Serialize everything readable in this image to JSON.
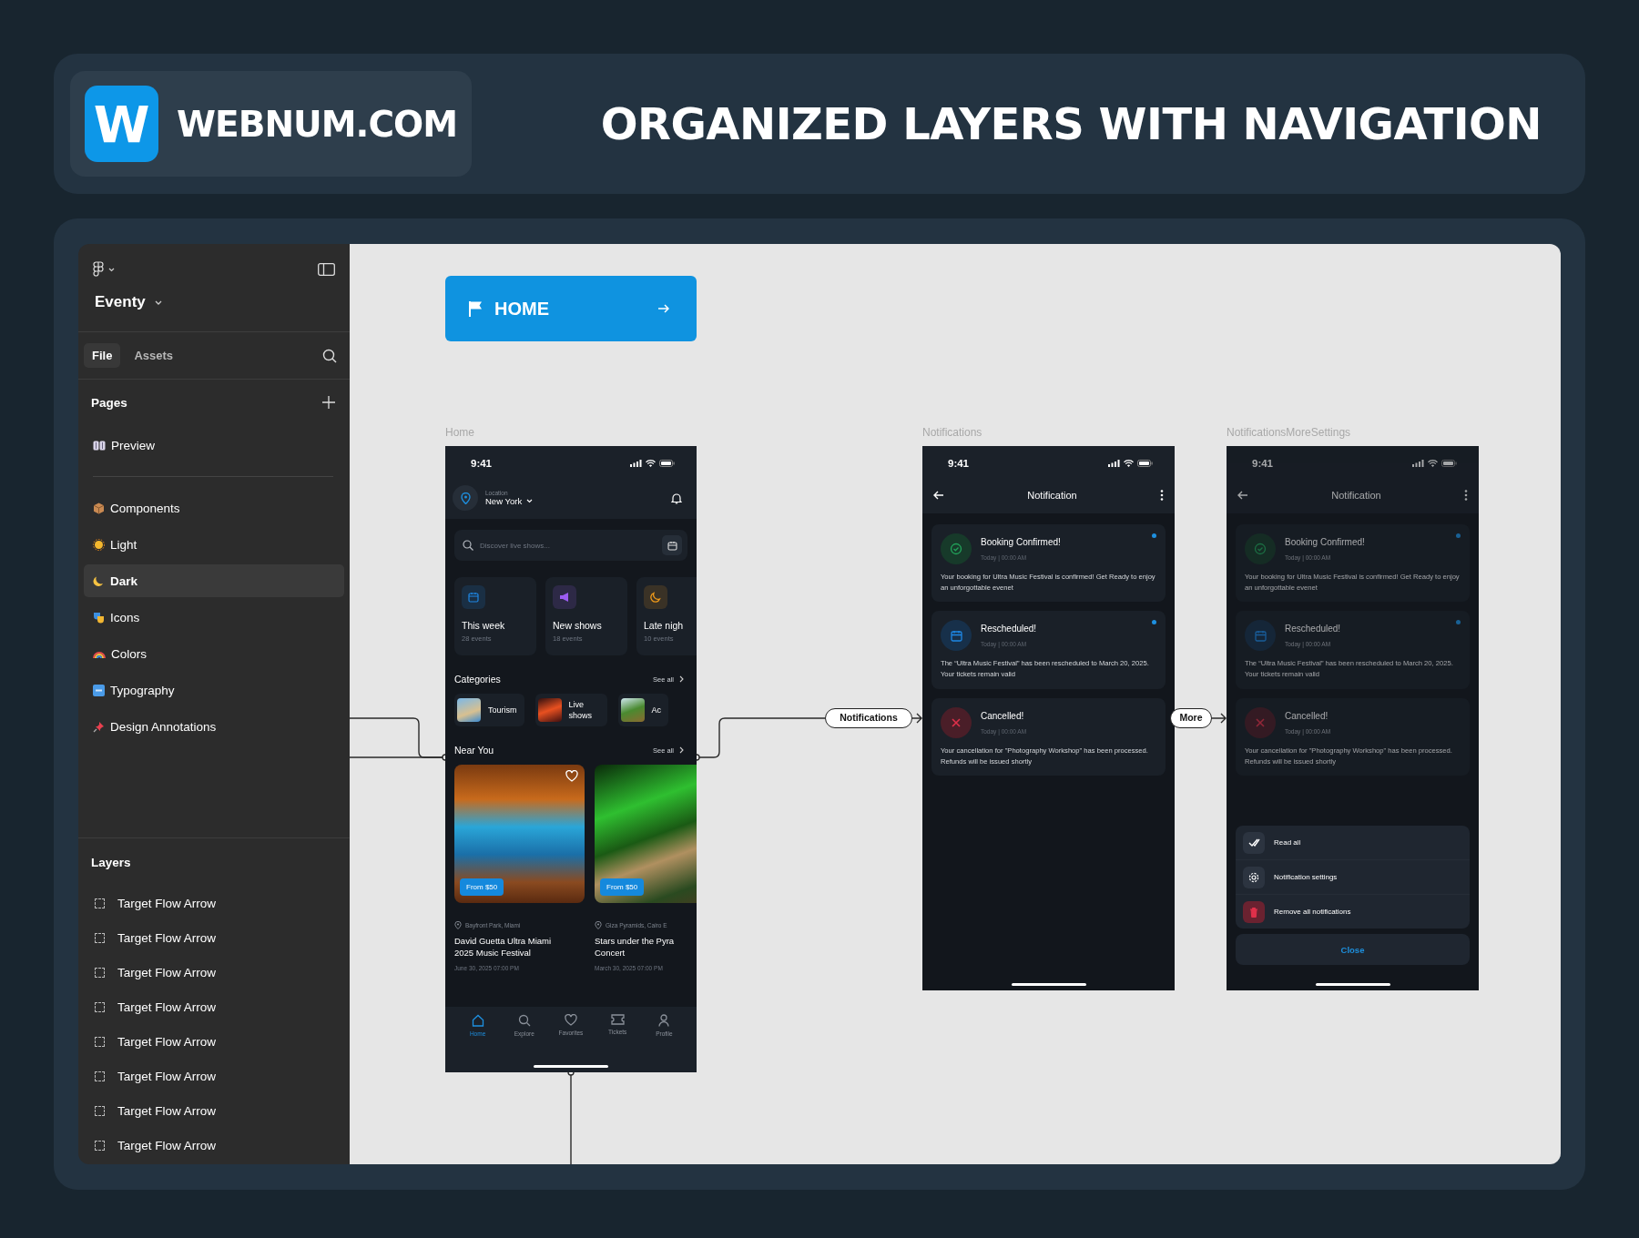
{
  "header": {
    "logo_text": "W",
    "brand": "WEBNUM.COM",
    "title": "ORGANIZED LAYERS WITH NAVIGATION"
  },
  "sidebar": {
    "project": "Eventy",
    "tabs": [
      {
        "label": "File",
        "selected": true
      },
      {
        "label": "Assets",
        "selected": false
      }
    ],
    "pages_heading": "Pages",
    "pinned_pages": [
      {
        "label": "Preview",
        "selected": false
      }
    ],
    "pages": [
      {
        "label": "Components",
        "selected": false
      },
      {
        "label": "Light",
        "selected": false
      },
      {
        "label": "Dark",
        "selected": true
      },
      {
        "label": "Icons",
        "selected": false
      },
      {
        "label": "Colors",
        "selected": false
      },
      {
        "label": "Typography",
        "selected": false
      },
      {
        "label": "Design Annotations",
        "selected": false
      }
    ],
    "layers_heading": "Layers",
    "layers": [
      "Target Flow Arrow",
      "Target Flow Arrow",
      "Target Flow Arrow",
      "Target Flow Arrow",
      "Target Flow Arrow",
      "Target Flow Arrow",
      "Target Flow Arrow",
      "Target Flow Arrow"
    ]
  },
  "canvas": {
    "home_button": "HOME",
    "connector_labels": [
      "Notifications",
      "More"
    ],
    "frames": [
      {
        "kind": "home",
        "name": "Home",
        "time": "9:41",
        "location_label": "Location",
        "location": "New York",
        "search_placeholder": "Discover live shows...",
        "quick": [
          {
            "title": "This week",
            "count": "28 events"
          },
          {
            "title": "New shows",
            "count": "18 events"
          },
          {
            "title": "Late nigh",
            "count": "10 events"
          }
        ],
        "categories_heading": "Categories",
        "categories_link": "See all",
        "categories": [
          "Tourism",
          "Live shows",
          "Ac"
        ],
        "near_heading": "Near You",
        "near_link": "See all",
        "events": [
          {
            "price": "From $50",
            "venue": "Bayfront Park, Miami",
            "title_lines": [
              "David Guetta Ultra Miami",
              "2025 Music Festival"
            ],
            "date": "June 30, 2025 07:00 PM"
          },
          {
            "price": "From $50",
            "venue": "Giza Pyramids, Cairo E",
            "title_lines": [
              "Stars under the Pyra",
              "Concert"
            ],
            "date": "March 30, 2025 07:00 PM"
          }
        ],
        "nav": [
          {
            "label": "Home",
            "selected": true
          },
          {
            "label": "Explore",
            "selected": false
          },
          {
            "label": "Favorites",
            "selected": false
          },
          {
            "label": "Tickets",
            "selected": false
          },
          {
            "label": "Profile",
            "selected": false
          }
        ]
      },
      {
        "kind": "notifications",
        "name": "Notifications",
        "time": "9:41",
        "title": "Notification",
        "items": [
          {
            "kind": "confirmed",
            "title": "Booking Confirmed!",
            "time": "Today | 00:00 AM",
            "body": "Your booking for Ultra Music Festival is confirmed! Get Ready to enjoy an unforgottable evenet",
            "unread": true
          },
          {
            "kind": "rescheduled",
            "title": "Rescheduled!",
            "time": "Today | 00:00 AM",
            "body": "The “Ultra Music Festival” has been rescheduled to March 20, 2025. Your tickets remain valid",
            "unread": true
          },
          {
            "kind": "cancelled",
            "title": "Cancelled!",
            "time": "Today | 00:00 AM",
            "body": "Your cancellation for \"Photography Workshop\" has been processed. Refunds will be issued shortly",
            "unread": false
          }
        ]
      },
      {
        "kind": "notifications",
        "name": "NotificationsMoreSettings",
        "time": "9:41",
        "title": "Notification",
        "items": [
          {
            "kind": "confirmed",
            "title": "Booking Confirmed!",
            "time": "Today | 00:00 AM",
            "body": "Your booking for Ultra Music Festival is confirmed! Get Ready to enjoy an unforgottable evenet",
            "unread": true
          },
          {
            "kind": "rescheduled",
            "title": "Rescheduled!",
            "time": "Today | 00:00 AM",
            "body": "The “Ultra Music Festival” has been rescheduled to March 20, 2025. Your tickets remain valid",
            "unread": true
          },
          {
            "kind": "cancelled",
            "title": "Cancelled!",
            "time": "Today | 00:00 AM",
            "body": "Your cancellation for \"Photography Workshop\" has been processed. Refunds will be issued shortly",
            "unread": false
          }
        ],
        "menu": [
          {
            "kind": "read",
            "label": "Read all"
          },
          {
            "kind": "settings",
            "label": "Notification settings"
          },
          {
            "kind": "remove",
            "label": "Remove all notifications"
          }
        ],
        "close": "Close"
      }
    ]
  }
}
